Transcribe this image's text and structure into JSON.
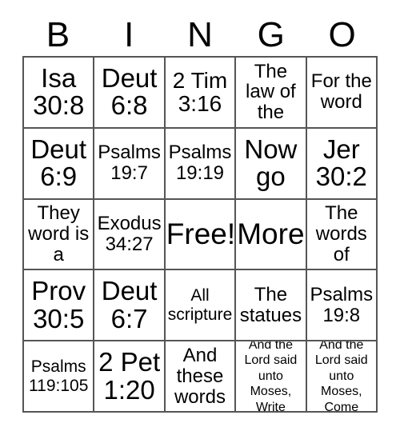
{
  "card": {
    "type": "bingo-card",
    "columns": 5,
    "rows": 5,
    "header": {
      "letters": [
        "B",
        "I",
        "N",
        "G",
        "O"
      ]
    },
    "colors": {
      "background": "#ffffff",
      "text": "#000000",
      "grid_line": "#555555"
    },
    "cells": [
      {
        "text": "Isa\n30:8",
        "size": "fs-xl"
      },
      {
        "text": "Deut\n6:8",
        "size": "fs-xl"
      },
      {
        "text": "2 Tim\n3:16",
        "size": "fs-lg"
      },
      {
        "text": "The\nlaw of\nthe",
        "size": "fs-md"
      },
      {
        "text": "For the\nword",
        "size": "fs-md"
      },
      {
        "text": "Deut\n6:9",
        "size": "fs-xl"
      },
      {
        "text": "Psalms\n19:7",
        "size": "fs-md"
      },
      {
        "text": "Psalms\n19:19",
        "size": "fs-md"
      },
      {
        "text": "Now\ngo",
        "size": "fs-xl"
      },
      {
        "text": "Jer\n30:2",
        "size": "fs-xl"
      },
      {
        "text": "They\nword is\na",
        "size": "fs-md"
      },
      {
        "text": "Exodus\n34:27",
        "size": "fs-md"
      },
      {
        "text": "Free!",
        "size": "fs-xxl"
      },
      {
        "text": "More",
        "size": "fs-xxl"
      },
      {
        "text": "The\nwords\nof",
        "size": "fs-md"
      },
      {
        "text": "Prov\n30:5",
        "size": "fs-xl"
      },
      {
        "text": "Deut\n6:7",
        "size": "fs-xl"
      },
      {
        "text": "All\nscripture",
        "size": "fs-sm"
      },
      {
        "text": "The\nstatues",
        "size": "fs-md"
      },
      {
        "text": "Psalms\n19:8",
        "size": "fs-md"
      },
      {
        "text": "Psalms\n119:105",
        "size": "fs-sm"
      },
      {
        "text": "2 Pet\n1:20",
        "size": "fs-xl"
      },
      {
        "text": "And\nthese\nwords",
        "size": "fs-md"
      },
      {
        "text": "And the\nLord said\nunto Moses,\nWrite",
        "size": "fs-xs"
      },
      {
        "text": "And the\nLord said\nunto Moses,\nCome",
        "size": "fs-xs"
      }
    ]
  }
}
